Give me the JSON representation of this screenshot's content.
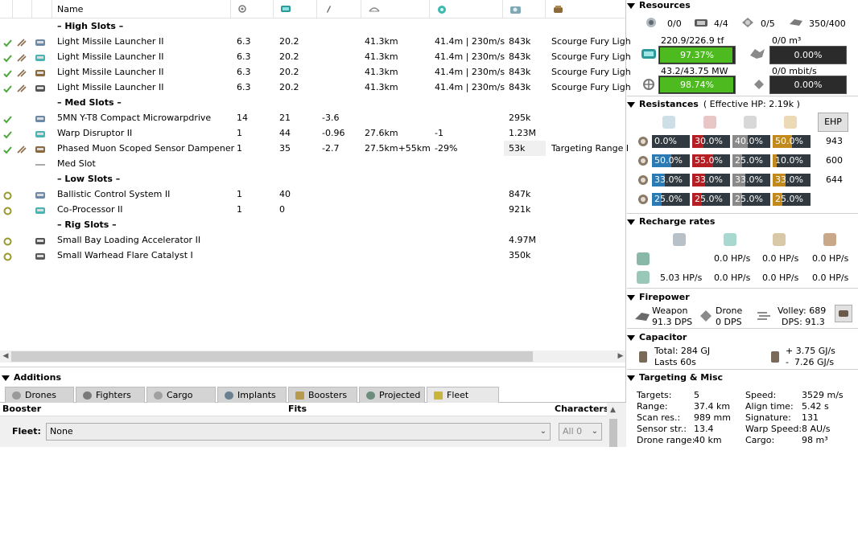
{
  "header": {
    "columns": [
      {
        "label": "Name",
        "icon": ""
      },
      {
        "label": "",
        "icon": "cpu-icon"
      },
      {
        "label": "",
        "icon": "powergrid-icon"
      },
      {
        "label": "",
        "icon": "capacitor-icon"
      },
      {
        "label": "",
        "icon": "range-icon"
      },
      {
        "label": "",
        "icon": "falloff-icon"
      },
      {
        "label": "",
        "icon": "price-icon"
      },
      {
        "label": "",
        "icon": "ammo-icon"
      }
    ]
  },
  "rows": [
    {
      "kind": "header",
      "name": "– High Slots –"
    },
    {
      "kind": "module",
      "state": "active",
      "name": "Light Missile Launcher II",
      "cpu": "6.3",
      "pg": "20.2",
      "cap": "",
      "range": "41.3km",
      "falloff": "41.4m | 230m/s",
      "price": "843k",
      "ammo": "Scourge Fury Ligh"
    },
    {
      "kind": "module",
      "state": "active",
      "name": "Light Missile Launcher II",
      "cpu": "6.3",
      "pg": "20.2",
      "cap": "",
      "range": "41.3km",
      "falloff": "41.4m | 230m/s",
      "price": "843k",
      "ammo": "Scourge Fury Ligh"
    },
    {
      "kind": "module",
      "state": "active",
      "name": "Light Missile Launcher II",
      "cpu": "6.3",
      "pg": "20.2",
      "cap": "",
      "range": "41.3km",
      "falloff": "41.4m | 230m/s",
      "price": "843k",
      "ammo": "Scourge Fury Ligh"
    },
    {
      "kind": "module",
      "state": "active",
      "name": "Light Missile Launcher II",
      "cpu": "6.3",
      "pg": "20.2",
      "cap": "",
      "range": "41.3km",
      "falloff": "41.4m | 230m/s",
      "price": "843k",
      "ammo": "Scourge Fury Ligh"
    },
    {
      "kind": "header",
      "name": "– Med Slots –"
    },
    {
      "kind": "module",
      "state": "active",
      "name": "5MN Y-T8 Compact Microwarpdrive",
      "cpu": "14",
      "pg": "21",
      "cap": "-3.6",
      "range": "",
      "falloff": "",
      "price": "295k",
      "ammo": ""
    },
    {
      "kind": "module",
      "state": "active",
      "name": "Warp Disruptor II",
      "cpu": "1",
      "pg": "44",
      "cap": "-0.96",
      "range": "27.6km",
      "falloff": "-1",
      "price": "1.23M",
      "ammo": ""
    },
    {
      "kind": "module",
      "state": "active",
      "name": "Phased Muon Scoped Sensor Dampener",
      "cpu": "1",
      "pg": "35",
      "cap": "-2.7",
      "range": "27.5km+55km",
      "falloff": "-29%",
      "price": "53k",
      "ammo": "Targeting Range I"
    },
    {
      "kind": "empty",
      "state": "none",
      "name": "Med Slot",
      "cpu": "",
      "pg": "",
      "cap": "",
      "range": "",
      "falloff": "",
      "price": "",
      "ammo": ""
    },
    {
      "kind": "header",
      "name": "– Low Slots –"
    },
    {
      "kind": "module",
      "state": "online",
      "name": "Ballistic Control System II",
      "cpu": "1",
      "pg": "40",
      "cap": "",
      "range": "",
      "falloff": "",
      "price": "847k",
      "ammo": ""
    },
    {
      "kind": "module",
      "state": "online",
      "name": "Co-Processor II",
      "cpu": "1",
      "pg": "0",
      "cap": "",
      "range": "",
      "falloff": "",
      "price": "921k",
      "ammo": ""
    },
    {
      "kind": "header",
      "name": "– Rig Slots –"
    },
    {
      "kind": "module",
      "state": "online",
      "name": "Small Bay Loading Accelerator II",
      "cpu": "",
      "pg": "",
      "cap": "",
      "range": "",
      "falloff": "",
      "price": "4.97M",
      "ammo": ""
    },
    {
      "kind": "module",
      "state": "online",
      "name": "Small Warhead Flare Catalyst I",
      "cpu": "",
      "pg": "",
      "cap": "",
      "range": "",
      "falloff": "",
      "price": "350k",
      "ammo": ""
    }
  ],
  "additions": {
    "title": "Additions",
    "tabs": [
      "Drones",
      "Fighters",
      "Cargo",
      "Implants",
      "Boosters",
      "Projected",
      "Fleet"
    ],
    "active_tab": "Fleet",
    "columns": {
      "booster": "Booster",
      "fits": "Fits",
      "characters": "Characters"
    },
    "fleet_label": "Fleet:",
    "fleet_value": "None",
    "all_value": "All 0"
  },
  "resources": {
    "title": "Resources",
    "counts": [
      "0/0",
      "4/4",
      "0/5",
      "350/400"
    ],
    "cpu": {
      "label": "220.9/226.9 tf",
      "value": "97.37%",
      "fraction": 0.9737
    },
    "drone_bay": {
      "label": "0/0 m³",
      "value": "0.00%",
      "fraction": 0
    },
    "powergrid": {
      "label": "43.2/43.75 MW",
      "value": "98.74%",
      "fraction": 0.9874
    },
    "bandwidth": {
      "label": "0/0 mbit/s",
      "value": "0.00%",
      "fraction": 0
    }
  },
  "resistances": {
    "title": "Resistances",
    "ehp_note": "( Effective HP: 2.19k )",
    "ehp_button": "EHP",
    "rows": [
      {
        "values": [
          "0.0%",
          "30.0%",
          "40.0%",
          "50.0%"
        ],
        "fractions": [
          0.0,
          0.3,
          0.4,
          0.5
        ],
        "ehp": "943"
      },
      {
        "values": [
          "50.0%",
          "55.0%",
          "25.0%",
          "10.0%"
        ],
        "fractions": [
          0.5,
          0.55,
          0.25,
          0.1
        ],
        "ehp": "600"
      },
      {
        "values": [
          "33.0%",
          "33.0%",
          "33.0%",
          "33.0%"
        ],
        "fractions": [
          0.33,
          0.33,
          0.33,
          0.33
        ],
        "ehp": "644"
      },
      {
        "values": [
          "25.0%",
          "25.0%",
          "25.0%",
          "25.0%"
        ],
        "fractions": [
          0.25,
          0.25,
          0.25,
          0.25
        ],
        "ehp": ""
      }
    ]
  },
  "recharge": {
    "title": "Recharge rates",
    "row1": [
      "0.0 HP/s",
      "0.0 HP/s",
      "0.0 HP/s"
    ],
    "row2": [
      "5.03 HP/s",
      "0.0 HP/s",
      "0.0 HP/s",
      "0.0 HP/s"
    ]
  },
  "firepower": {
    "title": "Firepower",
    "weapon_label": "Weapon",
    "weapon_dps": "91.3 DPS",
    "drone_label": "Drone",
    "drone_dps": "0 DPS",
    "volley": "Volley: 689",
    "dps": "DPS: 91.3"
  },
  "capacitor": {
    "title": "Capacitor",
    "total": "Total: 284 GJ",
    "lasts": "Lasts 60s",
    "plus": "+ 3.75 GJ/s",
    "minus": "-  7.26 GJ/s"
  },
  "targeting": {
    "title": "Targeting & Misc",
    "left": [
      {
        "label": "Targets:",
        "value": "5"
      },
      {
        "label": "Range:",
        "value": "37.4 km"
      },
      {
        "label": "Scan res.:",
        "value": "989 mm"
      },
      {
        "label": "Sensor str.:",
        "value": "13.4"
      },
      {
        "label": "Drone range:",
        "value": "40 km"
      }
    ],
    "right": [
      {
        "label": "Speed:",
        "value": "3529 m/s"
      },
      {
        "label": "Align time:",
        "value": "5.42 s"
      },
      {
        "label": "Signature:",
        "value": "131"
      },
      {
        "label": "Warp Speed:",
        "value": "8 AU/s"
      },
      {
        "label": "Cargo:",
        "value": "98 m³"
      }
    ]
  },
  "colors": {
    "em": "#2a7ab5",
    "thermal": "#b51f24",
    "kinetic": "#8a8a8a",
    "explosive": "#c28a1d",
    "res_bg": "#303a40",
    "bar_green": "#4dba1f"
  }
}
